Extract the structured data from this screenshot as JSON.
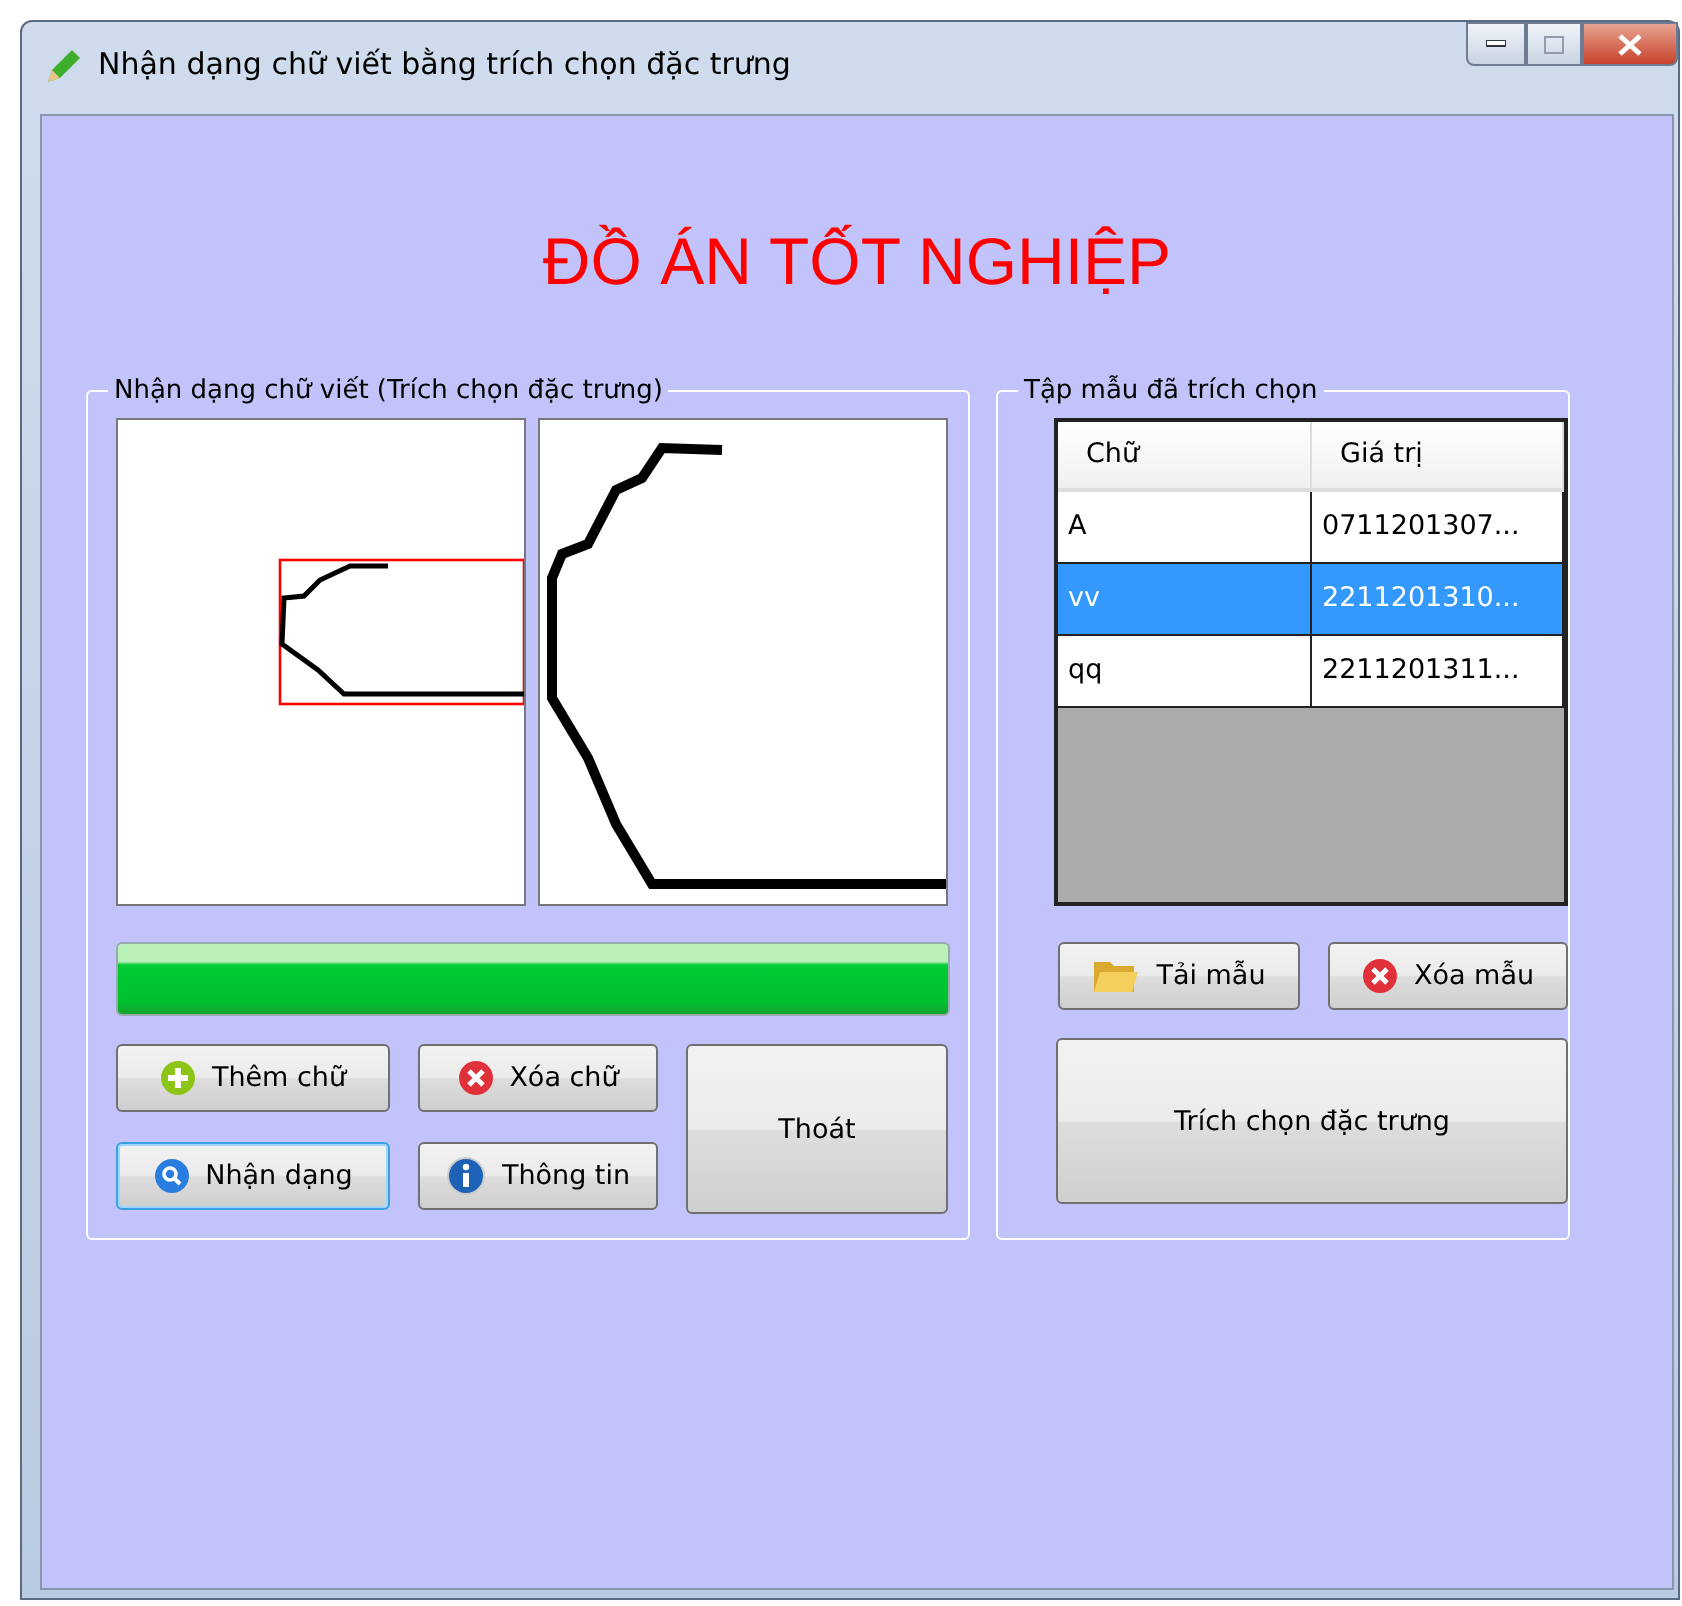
{
  "window": {
    "title": "Nhận dạng chữ viết bằng trích chọn đặc trưng"
  },
  "heading": "ĐỒ ÁN TỐT NGHIỆP",
  "recognition": {
    "legend": "Nhận dạng chữ viết (Trích chọn đặc trưng)",
    "progress": {
      "level": 1
    },
    "buttons": [
      {
        "label": "Thêm chữ",
        "kind": "add",
        "focused": false
      },
      {
        "label": "Xóa chữ",
        "kind": "delete",
        "focused": false
      },
      {
        "label": "Nhận dạng",
        "kind": "search",
        "focused": true
      },
      {
        "label": "Thông tin",
        "kind": "info",
        "focused": false
      }
    ],
    "exit_button": "Thoát"
  },
  "samples": {
    "legend": "Tập mẫu đã trích chọn",
    "columns": [
      "Chữ",
      "Giá trị"
    ],
    "rows": [
      {
        "cells": [
          "A",
          "0711201307..."
        ],
        "selected": false
      },
      {
        "cells": [
          "vv",
          "2211201310..."
        ],
        "selected": true
      },
      {
        "cells": [
          "qq",
          "2211201311..."
        ],
        "selected": false
      }
    ],
    "buttons": [
      {
        "label": "Tải mẫu",
        "kind": "folder"
      },
      {
        "label": "Xóa mẫu",
        "kind": "delete"
      }
    ],
    "extract_button": "Trích chọn đặc trưng"
  }
}
